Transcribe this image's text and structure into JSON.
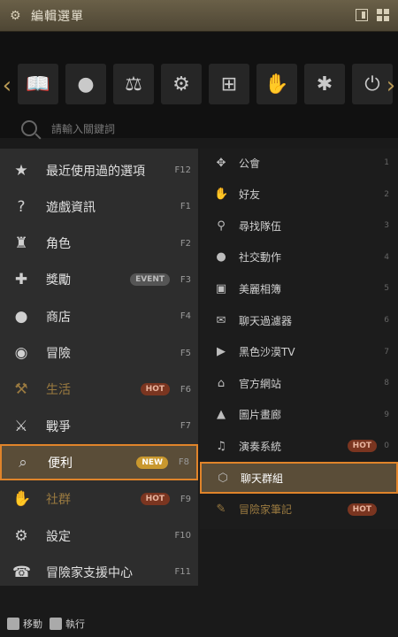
{
  "title": "編輯選單",
  "search": {
    "placeholder": "請輸入關鍵詞"
  },
  "toolbar_icons": [
    "book-icon",
    "globe-icon",
    "scales-icon",
    "gear-icon",
    "plus-box-icon",
    "hand-wave-icon",
    "network-icon",
    "power-icon"
  ],
  "left_items": [
    {
      "label": "最近使用過的選項",
      "key": "F12",
      "icon": "★",
      "name": "recent"
    },
    {
      "label": "遊戲資訊",
      "key": "F1",
      "icon": "?",
      "name": "game-info"
    },
    {
      "label": "角色",
      "key": "F2",
      "icon": "♜",
      "name": "character"
    },
    {
      "label": "獎勵",
      "key": "F3",
      "icon": "✚",
      "name": "rewards",
      "badge": "EVENT",
      "badge_type": "event"
    },
    {
      "label": "商店",
      "key": "F4",
      "icon": "●",
      "name": "shop"
    },
    {
      "label": "冒險",
      "key": "F5",
      "icon": "◉",
      "name": "adventure"
    },
    {
      "label": "生活",
      "key": "F6",
      "icon": "⚒",
      "name": "life",
      "badge": "HOT",
      "badge_type": "hot",
      "dim": true
    },
    {
      "label": "戰爭",
      "key": "F7",
      "icon": "⚔",
      "name": "war"
    },
    {
      "label": "便利",
      "key": "F8",
      "icon": "⌕",
      "name": "convenience",
      "badge": "NEW",
      "badge_type": "new",
      "selected": true
    },
    {
      "label": "社群",
      "key": "F9",
      "icon": "✋",
      "name": "community",
      "badge": "HOT",
      "badge_type": "hot",
      "dim": true
    },
    {
      "label": "設定",
      "key": "F10",
      "icon": "⚙",
      "name": "settings"
    },
    {
      "label": "冒險家支援中心",
      "key": "F11",
      "icon": "☎",
      "name": "support"
    }
  ],
  "right_items": [
    {
      "label": "公會",
      "key": "1",
      "icon": "✥",
      "name": "guild"
    },
    {
      "label": "好友",
      "key": "2",
      "icon": "✋",
      "name": "friends"
    },
    {
      "label": "尋找隊伍",
      "key": "3",
      "icon": "⚲",
      "name": "find-party"
    },
    {
      "label": "社交動作",
      "key": "4",
      "icon": "●",
      "name": "social-action"
    },
    {
      "label": "美麗相簿",
      "key": "5",
      "icon": "▣",
      "name": "album"
    },
    {
      "label": "聊天過濾器",
      "key": "6",
      "icon": "✉",
      "name": "chat-filter"
    },
    {
      "label": "黑色沙漠TV",
      "key": "7",
      "icon": "▶",
      "name": "tv"
    },
    {
      "label": "官方網站",
      "key": "8",
      "icon": "⌂",
      "name": "website"
    },
    {
      "label": "圖片畫廊",
      "key": "9",
      "icon": "▲",
      "name": "gallery"
    },
    {
      "label": "演奏系統",
      "key": "0",
      "icon": "♫",
      "name": "music",
      "badge": "HOT",
      "badge_type": "hot"
    },
    {
      "label": "聊天群組",
      "key": "",
      "icon": "⬡",
      "name": "chat-group",
      "selected": true
    },
    {
      "label": "冒險家筆記",
      "key": "",
      "icon": "✎",
      "name": "notes",
      "badge": "HOT",
      "badge_type": "hot",
      "dim": true
    }
  ],
  "bottom": {
    "move_label": "移動",
    "execute_label": "執行"
  }
}
